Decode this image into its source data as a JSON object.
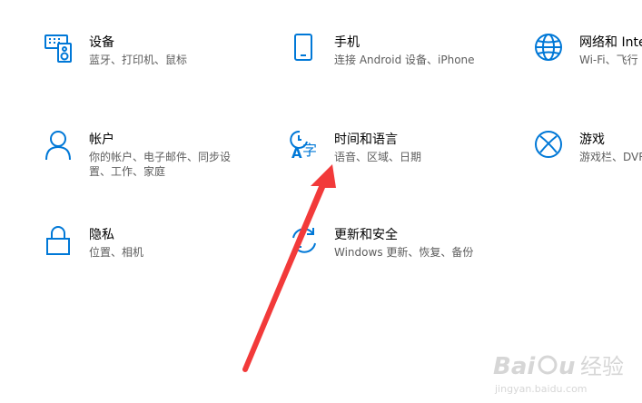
{
  "tiles": [
    {
      "id": "devices",
      "icon": "keyboard-speaker-icon",
      "title": "设备",
      "sub": "蓝牙、打印机、鼠标"
    },
    {
      "id": "phone",
      "icon": "phone-icon",
      "title": "手机",
      "sub": "连接 Android 设备、iPhone"
    },
    {
      "id": "network",
      "icon": "globe-icon",
      "title": "网络和 Inte",
      "sub": "Wi-Fi、飞行"
    },
    {
      "id": "accounts",
      "icon": "person-icon",
      "title": "帐户",
      "sub": "你的帐户、电子邮件、同步设",
      "sub2": "置、工作、家庭"
    },
    {
      "id": "time-language",
      "icon": "time-language-icon",
      "title": "时间和语言",
      "sub": "语音、区域、日期"
    },
    {
      "id": "gaming",
      "icon": "xbox-icon",
      "title": "游戏",
      "sub": "游戏栏、DVR"
    },
    {
      "id": "privacy",
      "icon": "lock-icon",
      "title": "隐私",
      "sub": "位置、相机"
    },
    {
      "id": "update-security",
      "icon": "sync-icon",
      "title": "更新和安全",
      "sub": "Windows 更新、恢复、备份"
    }
  ],
  "colors": {
    "accent": "#0078d7",
    "arrow": "#f23a3a"
  },
  "watermark": {
    "brand": "Baidu",
    "brand_cn": "经验",
    "url": "jingyan.baidu.com"
  }
}
